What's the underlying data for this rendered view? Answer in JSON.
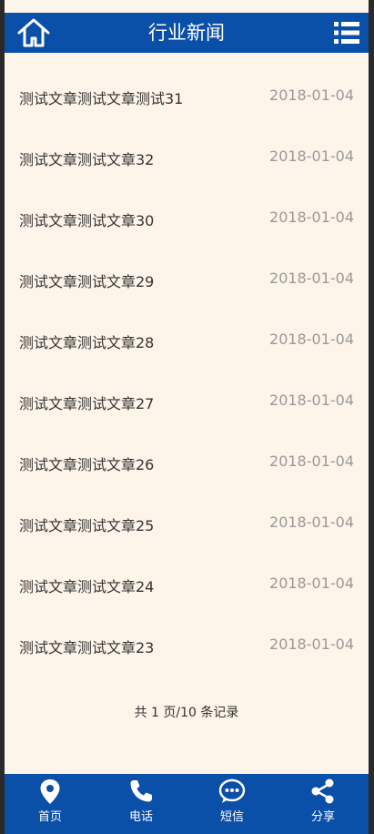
{
  "header": {
    "title": "行业新闻",
    "home_icon": "home-icon",
    "menu_icon": "list-menu-icon"
  },
  "articles": [
    {
      "title": "测试文章测试文章测试31",
      "date": "2018-01-04"
    },
    {
      "title": "测试文章测试文章32",
      "date": "2018-01-04"
    },
    {
      "title": "测试文章测试文章30",
      "date": "2018-01-04"
    },
    {
      "title": "测试文章测试文章29",
      "date": "2018-01-04"
    },
    {
      "title": "测试文章测试文章28",
      "date": "2018-01-04"
    },
    {
      "title": "测试文章测试文章27",
      "date": "2018-01-04"
    },
    {
      "title": "测试文章测试文章26",
      "date": "2018-01-04"
    },
    {
      "title": "测试文章测试文章25",
      "date": "2018-01-04"
    },
    {
      "title": "测试文章测试文章24",
      "date": "2018-01-04"
    },
    {
      "title": "测试文章测试文章23",
      "date": "2018-01-04"
    }
  ],
  "pagination": {
    "text": "共 1 页/10 条记录"
  },
  "footer": {
    "items": [
      {
        "label": "首页",
        "icon": "map-pin-icon"
      },
      {
        "label": "电话",
        "icon": "phone-icon"
      },
      {
        "label": "短信",
        "icon": "sms-icon"
      },
      {
        "label": "分享",
        "icon": "share-icon"
      }
    ]
  },
  "colors": {
    "brand": "#0a4fa8",
    "background": "#fdf5e9",
    "date_text": "#999999"
  }
}
